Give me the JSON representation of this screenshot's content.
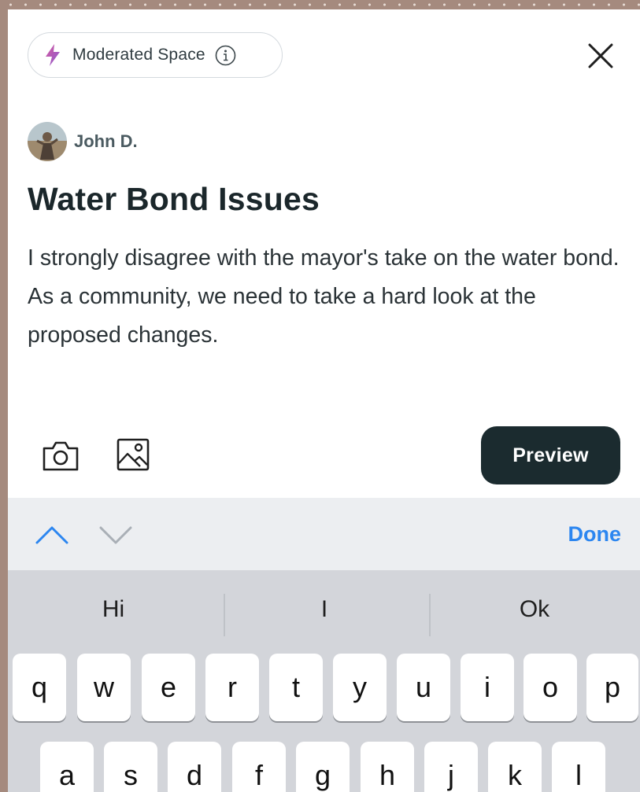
{
  "badge": {
    "label": "Moderated Space",
    "icon": "bolt-icon",
    "info_icon": "info-icon"
  },
  "close_icon": "close-icon",
  "author": {
    "name": "John D."
  },
  "post": {
    "title": "Water Bond Issues",
    "body": "I strongly disagree with the mayor's take on the water bond. As a community, we need to take a hard look at the proposed changes."
  },
  "toolbar": {
    "camera_icon": "camera-icon",
    "image_icon": "image-icon",
    "preview_label": "Preview"
  },
  "accessory": {
    "done_label": "Done"
  },
  "keyboard": {
    "suggestions": [
      "Hi",
      "I",
      "Ok"
    ],
    "row1": [
      "q",
      "w",
      "e",
      "r",
      "t",
      "y",
      "u",
      "i",
      "o",
      "p"
    ],
    "row2": [
      "a",
      "s",
      "d",
      "f",
      "g",
      "h",
      "j",
      "k",
      "l"
    ]
  },
  "colors": {
    "accent_blue": "#2c86f0",
    "preview_bg": "#1b2b2f",
    "bolt_pink": "#d65aa0",
    "bolt_purple": "#8a5bd1"
  }
}
